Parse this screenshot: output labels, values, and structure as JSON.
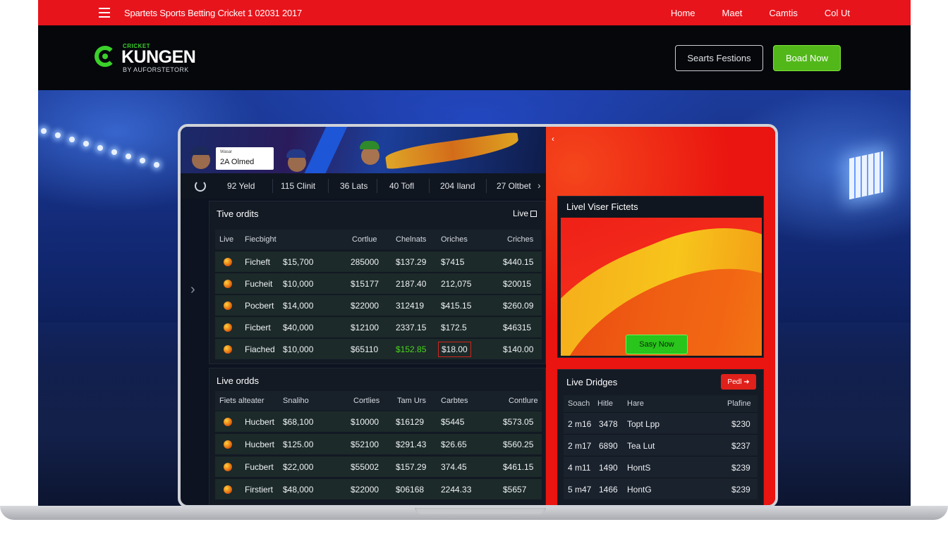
{
  "topbar": {
    "site_title": "Spartets Sports Betting Cricket 1 02031 2017",
    "nav": [
      "Home",
      "Maet",
      "Camtis",
      "Col Ut"
    ]
  },
  "header": {
    "logo_small": "CRICKET",
    "logo_big": "KUNGEN",
    "logo_sub": "BY AUFORSTETORK",
    "outline_button": "Searts Festions",
    "green_button": "Boad Now"
  },
  "banner": {
    "card_line1": "Wasar",
    "card_line2": "2A Olmed"
  },
  "stats": [
    "92 Yeld",
    "115 Clinit",
    "36 Lats",
    "40 Tofl",
    "204 Iland",
    "27 Oltbet"
  ],
  "table1": {
    "title": "Tive ordits",
    "badge": "Live",
    "headers": [
      "Live",
      "Fiecbight",
      "Cortlue",
      "Chelnats",
      "Oriches",
      "Criches"
    ],
    "rows": [
      [
        "Ficheft",
        "$15,700",
        "285000",
        "$137.29",
        "$7415",
        "$440.15"
      ],
      [
        "Fucheit",
        "$10,000",
        "$15177",
        "2187.40",
        "212,075",
        "$20015"
      ],
      [
        "Pocbert",
        "$14,000",
        "$22000",
        "312419",
        "$415.15",
        "$260.09"
      ],
      [
        "Ficbert",
        "$40,000",
        "$12100",
        "2337.15",
        "$172.5",
        "$46315"
      ],
      [
        "Fiached",
        "$10,000",
        "$65110",
        "$152.85",
        "$18.00",
        "$140.00"
      ]
    ]
  },
  "table2": {
    "title": "Live ordds",
    "headers": [
      "Fiets alteater",
      "Snaliho",
      "Cortlies",
      "Tam Urs",
      "Carbtes",
      "Contlure"
    ],
    "rows": [
      [
        "Hucbert",
        "$68,100",
        "$10000",
        "$16129",
        "$5445",
        "$573.05"
      ],
      [
        "Hucbert",
        "$125.00",
        "$52100",
        "$291.43",
        "$26.65",
        "$560.25"
      ],
      [
        "Fucbert",
        "$22,000",
        "$55002",
        "$157.29",
        "374.45",
        "$461.15"
      ],
      [
        "Firstiert",
        "$48,000",
        "$22000",
        "$06168",
        "2244.33",
        "$5657"
      ]
    ]
  },
  "viewer": {
    "title": "Livel Viser Fictets",
    "button": "Sasy Now"
  },
  "bridges": {
    "title": "Live Dridges",
    "button": "Pedl",
    "headers": [
      "Soach",
      "Hitle",
      "Hare",
      "Plafine"
    ],
    "rows": [
      [
        "2 m16",
        "3478",
        "Topt Lpp",
        "$230"
      ],
      [
        "2 m17",
        "6890",
        "Tea Lut",
        "$237"
      ],
      [
        "4 m11",
        "1490",
        "HontS",
        "$239"
      ],
      [
        "5 m47",
        "1466",
        "HontG",
        "$239"
      ]
    ]
  },
  "colors": {
    "brand_red": "#e8141c",
    "brand_green": "#52b81a",
    "panel_bg": "#131a24"
  }
}
